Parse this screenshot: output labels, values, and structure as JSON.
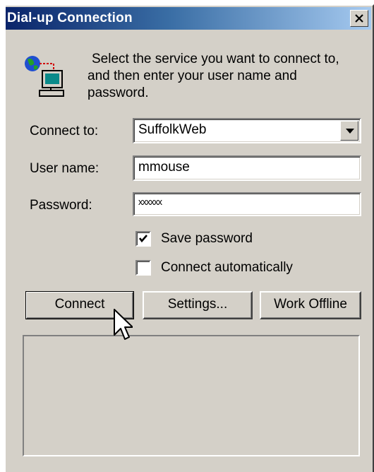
{
  "window": {
    "title": "Dial-up Connection"
  },
  "instructions": "Select the service you want to connect to, and then enter your user name and password.",
  "form": {
    "connect_to": {
      "label": "Connect to:",
      "value": "SuffolkWeb"
    },
    "user_name": {
      "label": "User name:",
      "value": "mmouse"
    },
    "password": {
      "label": "Password:",
      "value": "xxxxxx"
    },
    "save_password": {
      "label": "Save password",
      "checked": true
    },
    "connect_automatically": {
      "label": "Connect automatically",
      "checked": false
    }
  },
  "buttons": {
    "connect": "Connect",
    "settings": "Settings...",
    "work_offline": "Work Offline"
  },
  "icons": {
    "close": "close-icon",
    "dialog": "dial-up-computer-globe-icon",
    "dropdown": "chevron-down-icon",
    "checkmark": "checkmark-icon",
    "cursor": "mouse-pointer-icon"
  }
}
